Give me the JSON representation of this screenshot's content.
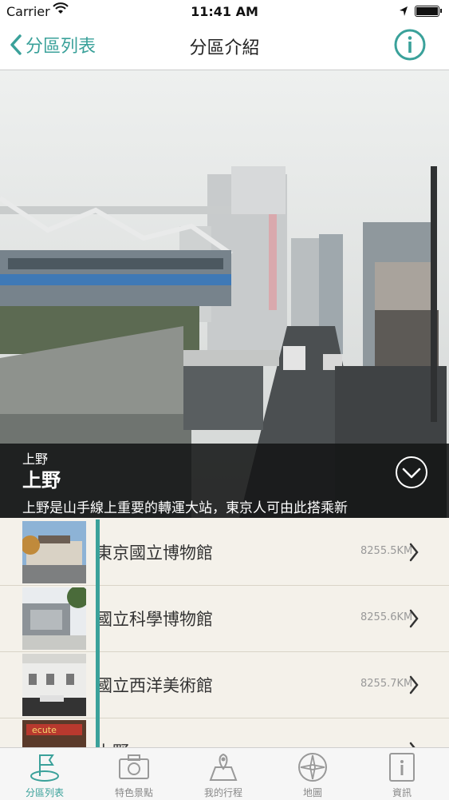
{
  "status_bar": {
    "carrier": "Carrier",
    "time": "11:41 AM"
  },
  "nav": {
    "back_label": "分區列表",
    "title": "分區介紹"
  },
  "hero": {
    "subtitle": "上野",
    "name": "上野",
    "description": "上野是山手線上重要的轉運大站，東京人可由此搭乘新"
  },
  "list": [
    {
      "name": "東京國立博物館",
      "distance": "8255.5KM"
    },
    {
      "name": "國立科學博物館",
      "distance": "8255.6KM"
    },
    {
      "name": "國立西洋美術館",
      "distance": "8255.7KM"
    },
    {
      "name": "上野",
      "distance": ""
    }
  ],
  "tabs": [
    {
      "label": "分區列表",
      "icon": "flag-icon",
      "active": true
    },
    {
      "label": "特色景點",
      "icon": "camera-icon",
      "active": false
    },
    {
      "label": "我的行程",
      "icon": "route-map-icon",
      "active": false
    },
    {
      "label": "地圖",
      "icon": "compass-icon",
      "active": false
    },
    {
      "label": "資訊",
      "icon": "info-doc-icon",
      "active": false
    }
  ],
  "colors": {
    "accent": "#3aa19a",
    "overlay": "#141616",
    "background": "#f4f1ea"
  }
}
